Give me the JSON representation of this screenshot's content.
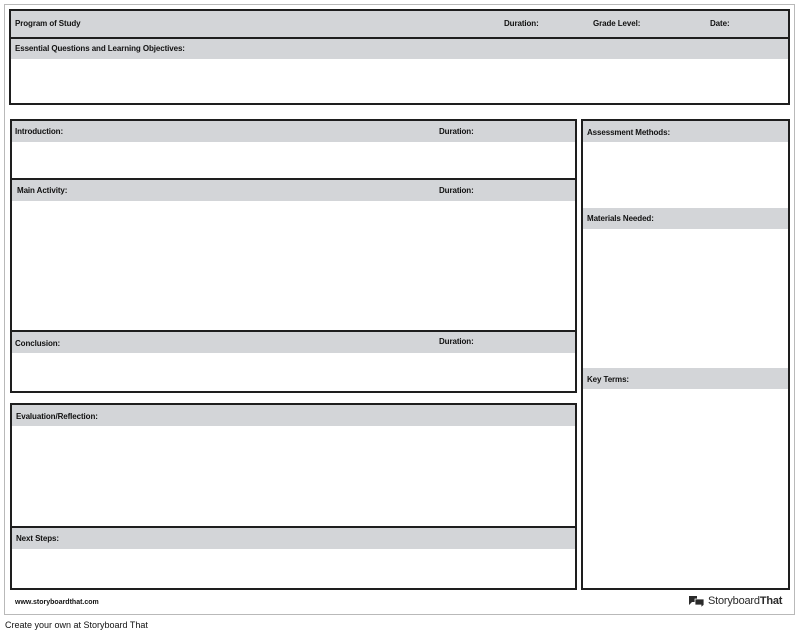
{
  "header": {
    "program_of_study": "Program of Study",
    "duration": "Duration:",
    "grade_level": "Grade Level:",
    "date": "Date:"
  },
  "essential": {
    "label": "Essential Questions and Learning Objectives:"
  },
  "introduction": {
    "label": "Introduction:",
    "duration": "Duration:"
  },
  "main_activity": {
    "label": "Main Activity:",
    "duration": "Duration:"
  },
  "conclusion": {
    "label": "Conclusion:",
    "duration": "Duration:"
  },
  "evaluation": {
    "label": "Evaluation/Reflection:"
  },
  "next_steps": {
    "label": "Next Steps:"
  },
  "sidebar": {
    "assessment": "Assessment Methods:",
    "materials": "Materials Needed:",
    "key_terms": "Key Terms:"
  },
  "footer": {
    "url": "www.storyboardthat.com",
    "logo_part1": "Storyboard",
    "logo_part2": "That",
    "caption": "Create your own at Storyboard That"
  },
  "colors": {
    "header_fill": "#d3d5d8",
    "border": "#1e1e1e"
  },
  "icons": {
    "logo": "storyboard-logo-icon"
  }
}
